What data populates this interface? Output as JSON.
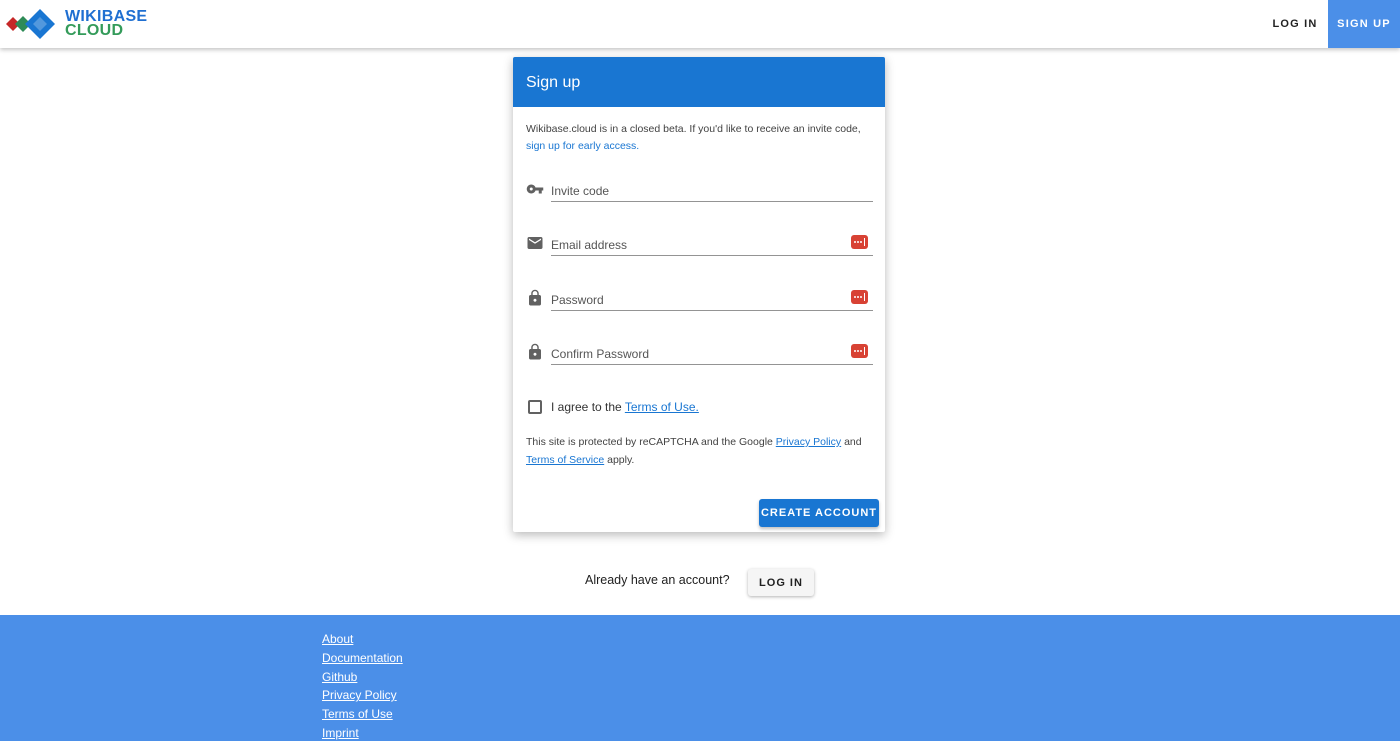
{
  "header": {
    "logo": {
      "line1": "WIKIBASE",
      "line2": "CLOUD",
      "colors": [
        "#c62828",
        "#2e8b57",
        "#1976d2"
      ]
    },
    "nav": {
      "login_label": "LOG IN",
      "signup_label": "SIGN UP"
    }
  },
  "signup_card": {
    "title": "Sign up",
    "intro_text": "Wikibase.cloud is in a closed beta. If you'd like to receive an invite code,",
    "intro_link": "sign up for early access.",
    "fields": {
      "invite_code": {
        "placeholder": "Invite code",
        "icon": "key-icon"
      },
      "email": {
        "placeholder": "Email address",
        "icon": "email-icon"
      },
      "password": {
        "placeholder": "Password",
        "icon": "lock-icon"
      },
      "confirm_password": {
        "placeholder": "Confirm Password",
        "icon": "lock-icon"
      }
    },
    "agree": {
      "prefix": "I agree to the",
      "link": "Terms of Use.",
      "checked": false
    },
    "recaptcha": {
      "prefix": "This site is protected by reCAPTCHA and the Google",
      "privacy_link": "Privacy Policy",
      "and": "and",
      "terms_link": "Terms of Service",
      "suffix": "apply."
    },
    "create_button": "CREATE ACCOUNT"
  },
  "login_prompt": {
    "text": "Already have an account?",
    "button": "LOG IN"
  },
  "footer": {
    "links": [
      "About",
      "Documentation",
      "Github",
      "Privacy Policy",
      "Terms of Use",
      "Imprint"
    ]
  },
  "colors": {
    "primary": "#1976d2",
    "nav_accent": "#4b8fe8",
    "footer": "#4b8fe8",
    "password_manager_badge": "#d84234"
  }
}
